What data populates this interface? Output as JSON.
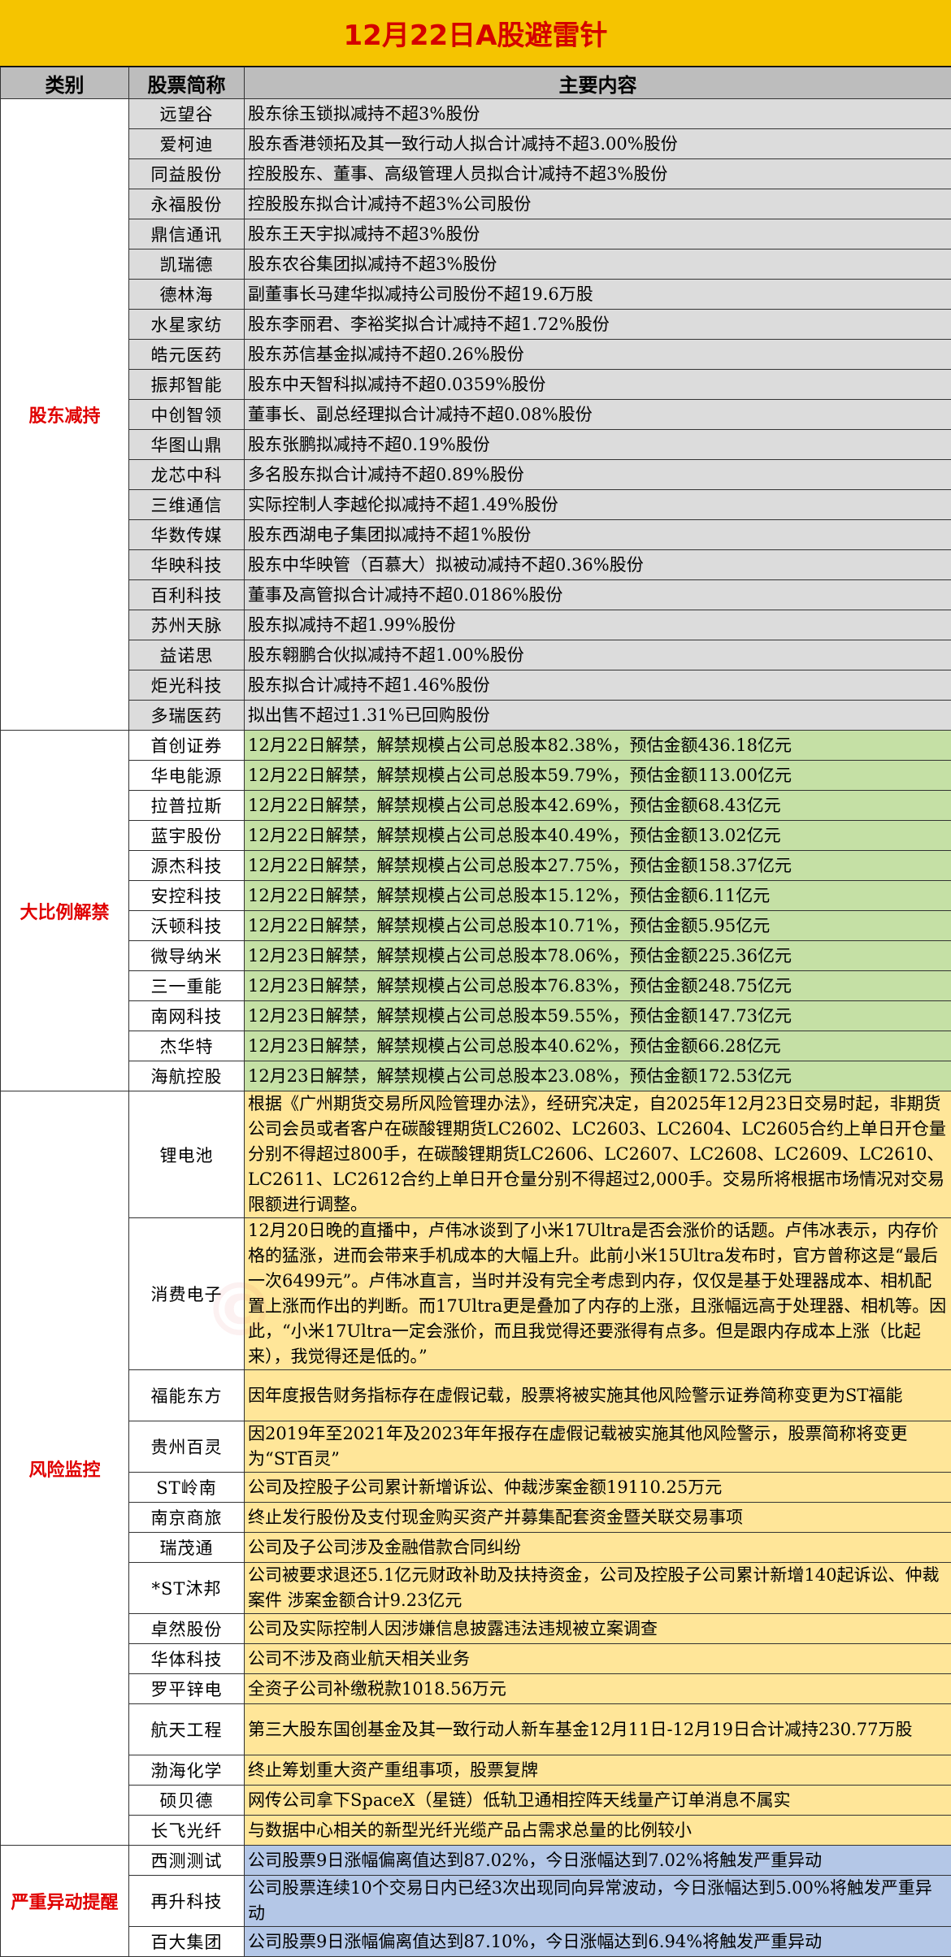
{
  "title": "12月22日A股避雷针",
  "headers": [
    "类别",
    "股票简称",
    "主要内容"
  ],
  "sections": {
    "reduce": {
      "category": "股东减持",
      "rows": [
        {
          "name": "远望谷",
          "content": "股东徐玉锁拟减持不超3%股份"
        },
        {
          "name": "爱柯迪",
          "content": "股东香港领拓及其一致行动人拟合计减持不超3.00%股份"
        },
        {
          "name": "同益股份",
          "content": "控股股东、董事、高级管理人员拟合计减持不超3%股份"
        },
        {
          "name": "永福股份",
          "content": "控股股东拟合计减持不超3%公司股份"
        },
        {
          "name": "鼎信通讯",
          "content": "股东王天宇拟减持不超3%股份"
        },
        {
          "name": "凯瑞德",
          "content": "股东农谷集团拟减持不超3%股份"
        },
        {
          "name": "德林海",
          "content": "副董事长马建华拟减持公司股份不超19.6万股"
        },
        {
          "name": "水星家纺",
          "content": "股东李丽君、李裕奖拟合计减持不超1.72%股份"
        },
        {
          "name": "皓元医药",
          "content": "股东苏信基金拟减持不超0.26%股份"
        },
        {
          "name": "振邦智能",
          "content": "股东中天智科拟减持不超0.0359%股份"
        },
        {
          "name": "中创智领",
          "content": "董事长、副总经理拟合计减持不超0.08%股份"
        },
        {
          "name": "华图山鼎",
          "content": "股东张鹏拟减持不超0.19%股份"
        },
        {
          "name": "龙芯中科",
          "content": "多名股东拟合计减持不超0.89%股份"
        },
        {
          "name": "三维通信",
          "content": "实际控制人李越伦拟减持不超1.49%股份"
        },
        {
          "name": "华数传媒",
          "content": "股东西湖电子集团拟减持不超1%股份"
        },
        {
          "name": "华映科技",
          "content": "股东中华映管（百慕大）拟被动减持不超0.36%股份"
        },
        {
          "name": "百利科技",
          "content": "董事及高管拟合计减持不超0.0186%股份"
        },
        {
          "name": "苏州天脉",
          "content": "股东拟减持不超1.99%股份"
        },
        {
          "name": "益诺思",
          "content": "股东翱鹏合伙拟减持不超1.00%股份"
        },
        {
          "name": "炬光科技",
          "content": "股东拟合计减持不超1.46%股份"
        },
        {
          "name": "多瑞医药",
          "content": "拟出售不超过1.31%已回购股份"
        }
      ]
    },
    "unlock": {
      "category": "大比例解禁",
      "rows": [
        {
          "name": "首创证券",
          "content": "12月22日解禁，解禁规模占公司总股本82.38%，预估金额436.18亿元"
        },
        {
          "name": "华电能源",
          "content": "12月22日解禁，解禁规模占公司总股本59.79%，预估金额113.00亿元"
        },
        {
          "name": "拉普拉斯",
          "content": "12月22日解禁，解禁规模占公司总股本42.69%，预估金额68.43亿元"
        },
        {
          "name": "蓝宇股份",
          "content": "12月22日解禁，解禁规模占公司总股本40.49%，预估金额13.02亿元"
        },
        {
          "name": "源杰科技",
          "content": "12月22日解禁，解禁规模占公司总股本27.75%，预估金额158.37亿元"
        },
        {
          "name": "安控科技",
          "content": "12月22日解禁，解禁规模占公司总股本15.12%，预估金额6.11亿元"
        },
        {
          "name": "沃顿科技",
          "content": "12月22日解禁，解禁规模占公司总股本10.71%，预估金额5.95亿元"
        },
        {
          "name": "微导纳米",
          "content": "12月23日解禁，解禁规模占公司总股本78.06%，预估金额225.36亿元"
        },
        {
          "name": "三一重能",
          "content": "12月23日解禁，解禁规模占公司总股本76.83%，预估金额248.75亿元"
        },
        {
          "name": "南网科技",
          "content": "12月23日解禁，解禁规模占公司总股本59.55%，预估金额147.73亿元"
        },
        {
          "name": "杰华特",
          "content": "12月23日解禁，解禁规模占公司总股本40.62%，预估金额66.28亿元"
        },
        {
          "name": "海航控股",
          "content": "12月23日解禁，解禁规模占公司总股本23.08%，预估金额172.53亿元"
        }
      ]
    },
    "risk": {
      "category": "风险监控",
      "rows": [
        {
          "name": "锂电池",
          "content": "根据《广州期货交易所风险管理办法》，经研究决定，自2025年12月23日交易时起，非期货公司会员或者客户在碳酸锂期货LC2602、LC2603、LC2604、LC2605合约上单日开仓量分别不得超过800手，在碳酸锂期货LC2606、LC2607、LC2608、LC2609、LC2610、LC2611、LC2612合约上单日开仓量分别不得超过2,000手。交易所将根据市场情况对交易限额进行调整。"
        },
        {
          "name": "消费电子",
          "content": "12月20日晚的直播中，卢伟冰谈到了小米17Ultra是否会涨价的话题。卢伟冰表示，内存价格的猛涨，进而会带来手机成本的大幅上升。此前小米15Ultra发布时，官方曾称这是“最后一次6499元”。卢伟冰直言，当时并没有完全考虑到内存，仅仅是基于处理器成本、相机配置上涨而作出的判断。而17Ultra更是叠加了内存的上涨，且涨幅远高于处理器、相机等。因此，“小米17Ultra一定会涨价，而且我觉得还要涨得有点多。但是跟内存成本上涨（比起来），我觉得还是低的。”"
        },
        {
          "name": "福能东方",
          "content": "因年度报告财务指标存在虚假记载，股票将被实施其他风险警示证券简称变更为ST福能"
        },
        {
          "name": "贵州百灵",
          "content": "因2019年至2021年及2023年年报存在虚假记载被实施其他风险警示，股票简称将变更为“ST百灵”"
        },
        {
          "name": "ST岭南",
          "content": "公司及控股子公司累计新增诉讼、仲裁涉案金额19110.25万元"
        },
        {
          "name": "南京商旅",
          "content": "终止发行股份及支付现金购买资产并募集配套资金暨关联交易事项"
        },
        {
          "name": "瑞茂通",
          "content": "公司及子公司涉及金融借款合同纠纷"
        },
        {
          "name": "*ST沐邦",
          "content": "公司被要求退还5.1亿元财政补助及扶持资金，公司及控股子公司累计新增140起诉讼、仲裁案件 涉案金额合计9.23亿元"
        },
        {
          "name": "卓然股份",
          "content": "公司及实际控制人因涉嫌信息披露违法违规被立案调查"
        },
        {
          "name": "华体科技",
          "content": "公司不涉及商业航天相关业务"
        },
        {
          "name": "罗平锌电",
          "content": "全资子公司补缴税款1018.56万元"
        },
        {
          "name": "航天工程",
          "content": "第三大股东国创基金及其一致行动人新车基金12月11日-12月19日合计减持230.77万股"
        },
        {
          "name": "渤海化学",
          "content": "终止筹划重大资产重组事项，股票复牌"
        },
        {
          "name": "硕贝德",
          "content": "网传公司拿下SpaceX（星链）低轨卫通相控阵天线量产订单消息不属实"
        },
        {
          "name": "长飞光纤",
          "content": "与数据中心相关的新型光纤光缆产品占需求总量的比例较小"
        }
      ]
    },
    "abnormal": {
      "category": "严重异动提醒",
      "rows": [
        {
          "name": "西测测试",
          "content": "公司股票9日涨幅偏离值达到87.02%，今日涨幅达到7.02%将触发严重异动"
        },
        {
          "name": "再升科技",
          "content": "公司股票连续10个交易日内已经3次出现同向异常波动，今日涨幅达到5.00%将触发严重异动"
        },
        {
          "name": "百大集团",
          "content": "公司股票9日涨幅偏离值达到87.10%，今日涨幅达到6.94%将触发严重异动"
        }
      ]
    }
  },
  "colors": {
    "title_bg": "#f5c400",
    "title_text": "#d40000",
    "header_bg": "#bdbdbd",
    "reduce_bg": "#dcdcdc",
    "unlock_bg": "#c5e0a5",
    "risk_bg": "#ffe699",
    "abnormal_bg": "#b4c7e7",
    "category_text": "#e00000"
  }
}
